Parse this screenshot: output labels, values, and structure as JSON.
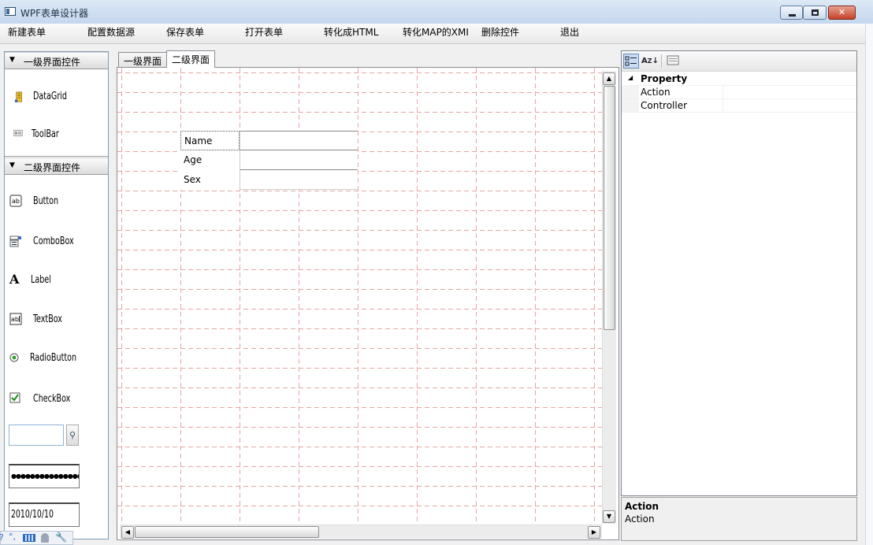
{
  "window": {
    "title": "WPF表单设计器"
  },
  "menu": {
    "items": [
      {
        "label": "新建表单"
      },
      {
        "label": "配置数据源"
      },
      {
        "label": "保存表单"
      },
      {
        "label": "打开表单"
      },
      {
        "label": "转化成HTML"
      },
      {
        "label": "转化MAP的XMI"
      },
      {
        "label": "删除控件"
      },
      {
        "label": "退出"
      }
    ]
  },
  "toolbox": {
    "group1": {
      "title": "一级界面控件",
      "items": [
        {
          "label": "DataGrid"
        },
        {
          "label": "ToolBar"
        }
      ]
    },
    "group2": {
      "title": "二级界面控件",
      "items": [
        {
          "label": "Button"
        },
        {
          "label": "ComboBox"
        },
        {
          "label": "Label"
        },
        {
          "label": "TextBox"
        },
        {
          "label": "RadioButton"
        },
        {
          "label": "CheckBox"
        }
      ]
    },
    "password_value": "●●●●●●●●●●●●●●●",
    "date_value": "2010/10/10"
  },
  "designer": {
    "tabs": [
      {
        "label": "一级界面",
        "active": false
      },
      {
        "label": "二级界面",
        "active": true
      }
    ],
    "fields": [
      {
        "label": "Name"
      },
      {
        "label": "Age"
      },
      {
        "label": "Sex"
      }
    ]
  },
  "property_grid": {
    "category": "Property",
    "properties": [
      {
        "name": "Action",
        "value": ""
      },
      {
        "name": "Controller",
        "value": ""
      }
    ],
    "description": {
      "title": "Action",
      "text": "Action"
    }
  },
  "colors": {
    "grid_line": "#e8a4a4",
    "accent": "#3399ff"
  }
}
